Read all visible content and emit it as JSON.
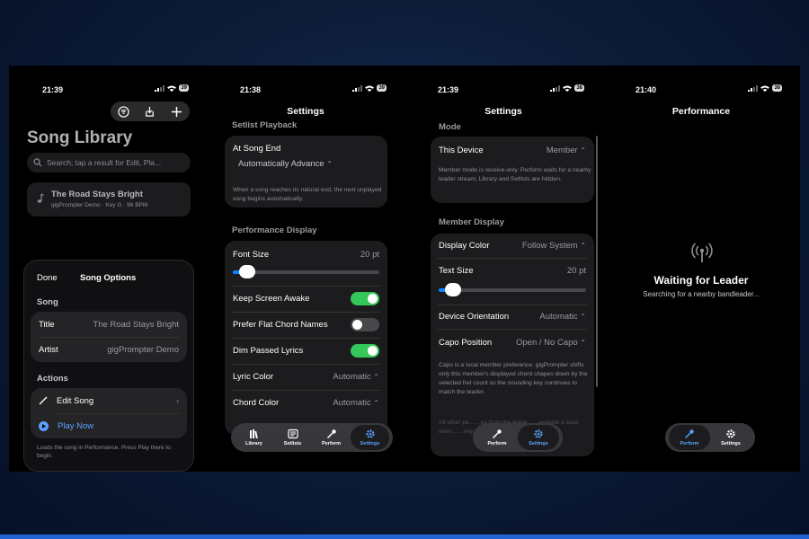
{
  "status_icons": [
    "cellular-signal-icon",
    "wifi-icon",
    "battery-icon"
  ],
  "screens": {
    "library": {
      "time": "21:39",
      "battery": "39",
      "title": "Song Library",
      "search_placeholder": "Search; tap a result for Edit, Pla...",
      "song": {
        "title": "The Road Stays Bright",
        "meta": "gigPrompter Demo · Key G · 96 BPM"
      },
      "sheet": {
        "done": "Done",
        "title": "Song Options",
        "song_section": "Song",
        "title_label": "Title",
        "title_value": "The Road Stays Bright",
        "artist_label": "Artist",
        "artist_value": "gigPrompter Demo",
        "actions_section": "Actions",
        "edit": "Edit Song",
        "play": "Play Now",
        "footer": "Loads the song in Performance. Press Play there to begin."
      }
    },
    "settings1": {
      "time": "21:38",
      "battery": "39",
      "title": "Settings",
      "setlist_header": "Setlist Playback",
      "at_song_end": "At Song End",
      "at_song_end_value": "Automatically Advance",
      "setlist_footer": "When a song reaches its natural end, the next unplayed song begins automatically.",
      "perf_header": "Performance Display",
      "font_size": "Font Size",
      "font_size_value": "20 pt",
      "font_slider_fraction": 0.1,
      "keep_awake": "Keep Screen Awake",
      "keep_awake_on": true,
      "flat_chords": "Prefer Flat Chord Names",
      "flat_chords_on": false,
      "dim_lyrics": "Dim Passed Lyrics",
      "dim_lyrics_on": true,
      "lyric_color": "Lyric Color",
      "lyric_color_value": "Automatic",
      "chord_color": "Chord Color",
      "chord_color_value": "Automatic",
      "tabs": [
        "Library",
        "Setlists",
        "Perform",
        "Settings"
      ],
      "selected_tab": "Settings"
    },
    "settings2": {
      "time": "21:39",
      "battery": "38",
      "title": "Settings",
      "mode_header": "Mode",
      "this_device": "This Device",
      "this_device_value": "Member",
      "mode_footer": "Member mode is receive-only. Perform waits for a nearby leader stream; Library and Setlists are hidden.",
      "member_header": "Member Display",
      "display_color": "Display Color",
      "display_color_value": "Follow System",
      "text_size": "Text Size",
      "text_size_value": "20 pt",
      "text_slider_fraction": 0.1,
      "orientation": "Device Orientation",
      "orientation_value": "Automatic",
      "capo": "Capo Position",
      "capo_value": "Open / No Capo",
      "capo_footer": "Capo is a local member preference. gigPrompter shifts only this member's displayed chord shapes down by the selected fret count so the sounding key continues to match the leader.",
      "faded_footer": "All other pe... ...es from the leade... ...enerate a local mem... ...ney",
      "tabs": [
        "Perform",
        "Settings"
      ],
      "selected_tab": "Settings"
    },
    "performance": {
      "time": "21:40",
      "battery": "38",
      "title": "Performance",
      "waiting": "Waiting for Leader",
      "searching": "Searching for a nearby bandleader...",
      "tabs": [
        "Perform",
        "Settings"
      ],
      "selected_tab": "Perform"
    }
  },
  "colors": {
    "accent": "#0a84ff",
    "toggle_on": "#34c759",
    "background": "#000000",
    "card": "#1c1c1e"
  }
}
